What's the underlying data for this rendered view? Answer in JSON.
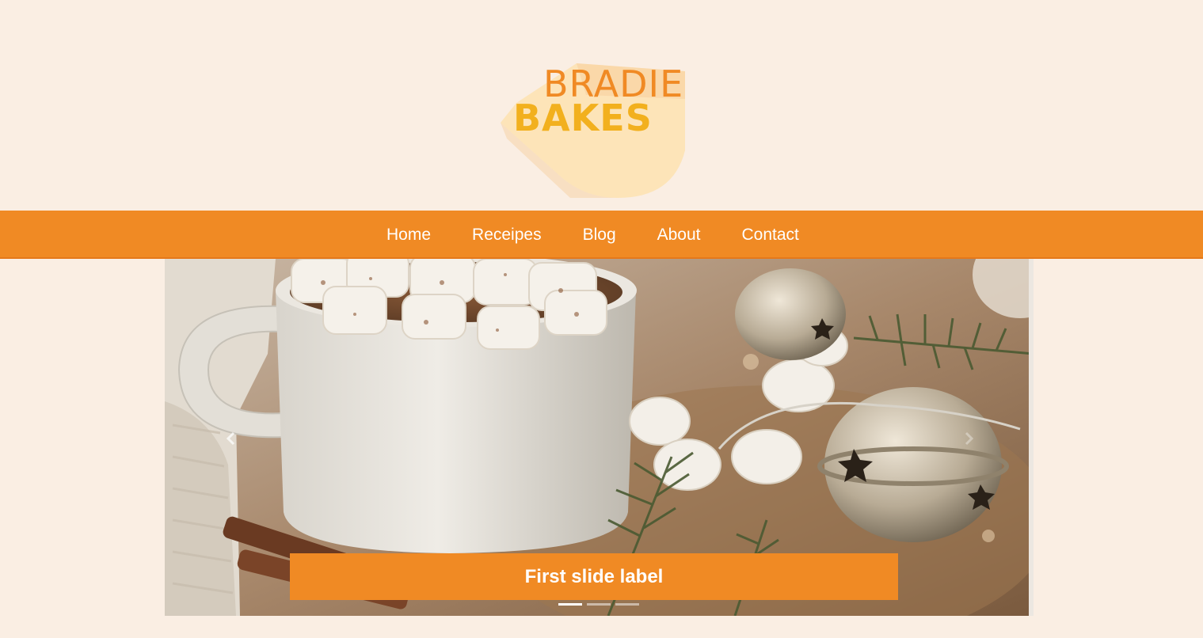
{
  "brand": {
    "line1": "BRADIE",
    "line2": "BAKES",
    "primary_color": "#f08a24",
    "logo_text_color": "#f2a21e",
    "logo_blob_color": "#fde2b0"
  },
  "nav": {
    "items": [
      {
        "label": "Home"
      },
      {
        "label": "Receipes"
      },
      {
        "label": "Blog"
      },
      {
        "label": "About"
      },
      {
        "label": "Contact"
      }
    ]
  },
  "carousel": {
    "caption": "First slide label",
    "slide_count": 3,
    "active_index": 0,
    "prev_icon": "chevron-left-icon",
    "next_icon": "chevron-right-icon"
  },
  "colors": {
    "background": "#faeee3",
    "nav_background": "#f08a24",
    "caption_background": "#f08a24",
    "text_on_accent": "#ffffff"
  }
}
